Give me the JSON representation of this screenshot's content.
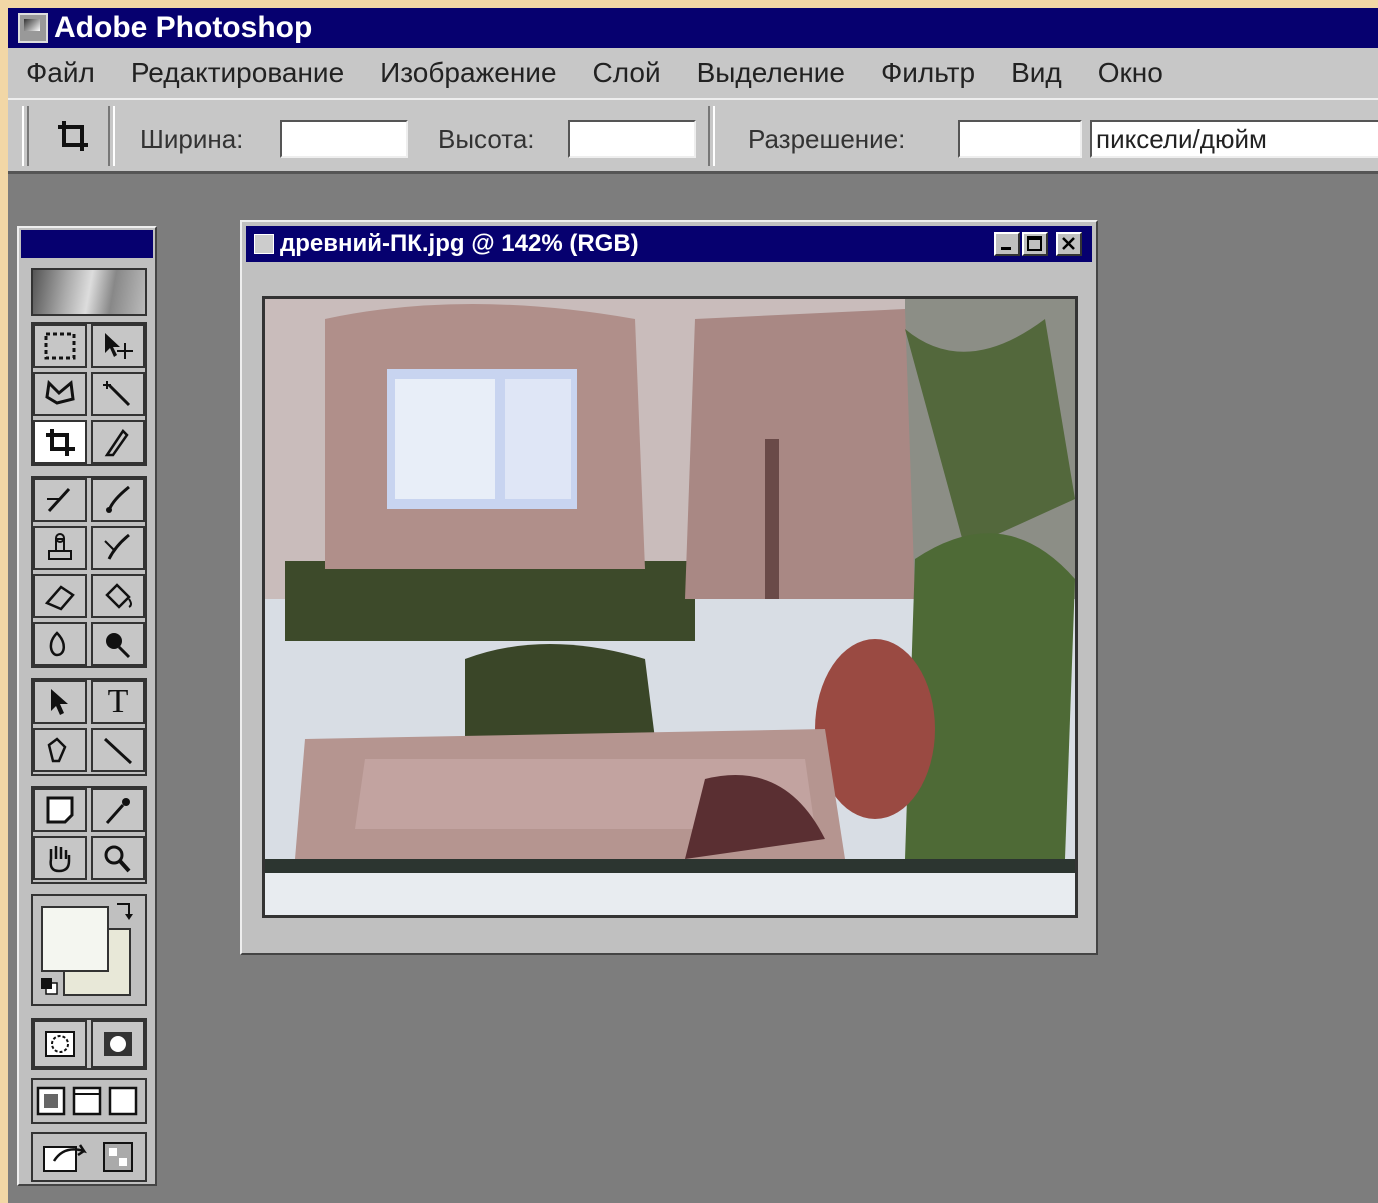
{
  "app": {
    "title": "Adobe Photoshop"
  },
  "menubar": {
    "items": [
      "Файл",
      "Редактирование",
      "Изображение",
      "Слой",
      "Выделение",
      "Фильтр",
      "Вид",
      "Окно"
    ]
  },
  "options": {
    "width_label": "Ширина:",
    "width_value": "",
    "height_label": "Высота:",
    "height_value": "",
    "resolution_label": "Разрешение:",
    "resolution_value": "",
    "resolution_unit": "пиксели/дюйм"
  },
  "document": {
    "title": "древний-ПК.jpg @ 142% (RGB)"
  },
  "tools": {
    "text_tool_glyph": "T"
  },
  "colors": {
    "titlebar": "#06006f",
    "workspace": "#7d7d7d",
    "foreground_swatch": "#f4f6f0",
    "background_swatch": "#e8e8d8"
  }
}
